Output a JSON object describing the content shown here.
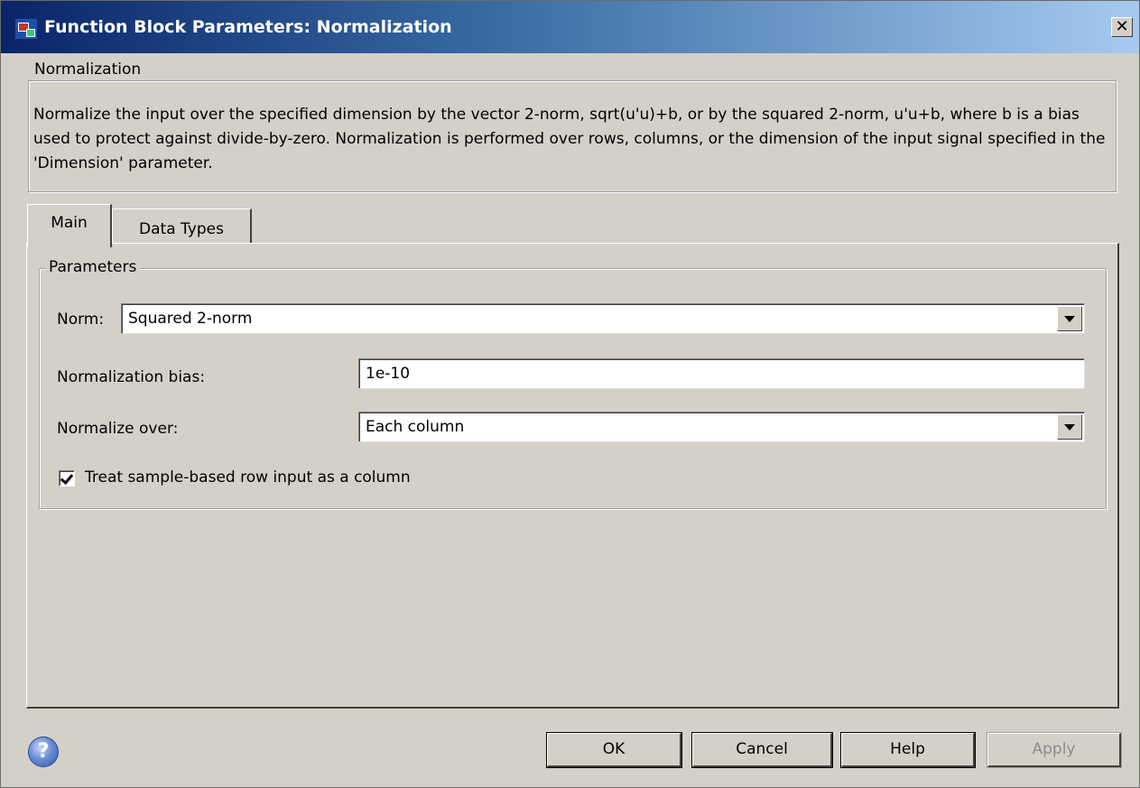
{
  "window": {
    "title": "Function Block Parameters: Normalization",
    "close_glyph": "✕"
  },
  "description_group": {
    "legend": "Normalization",
    "text": "Normalize the input over the specified dimension by the vector 2-norm, sqrt(u'u)+b, or by the squared 2-norm, u'u+b, where b is a bias used to protect against divide-by-zero.  Normalization is performed over rows, columns, or the dimension of the input signal specified in the 'Dimension' parameter."
  },
  "tabs": [
    {
      "label": "Main",
      "active": true
    },
    {
      "label": "Data Types",
      "active": false
    }
  ],
  "parameters": {
    "legend": "Parameters",
    "norm_label": "Norm:",
    "norm_value": "Squared 2-norm",
    "bias_label": "Normalization bias:",
    "bias_value": "1e-10",
    "over_label": "Normalize over:",
    "over_value": "Each column",
    "checkbox_label": "Treat sample-based row input as a column",
    "checkbox_checked": true
  },
  "buttons": {
    "help_icon": "?",
    "ok": "OK",
    "cancel": "Cancel",
    "help": "Help",
    "apply": "Apply",
    "apply_enabled": false
  },
  "colors": {
    "title_gradient_start": "#0a246a",
    "title_gradient_end": "#a6caf0",
    "face": "#d4d0c8"
  }
}
